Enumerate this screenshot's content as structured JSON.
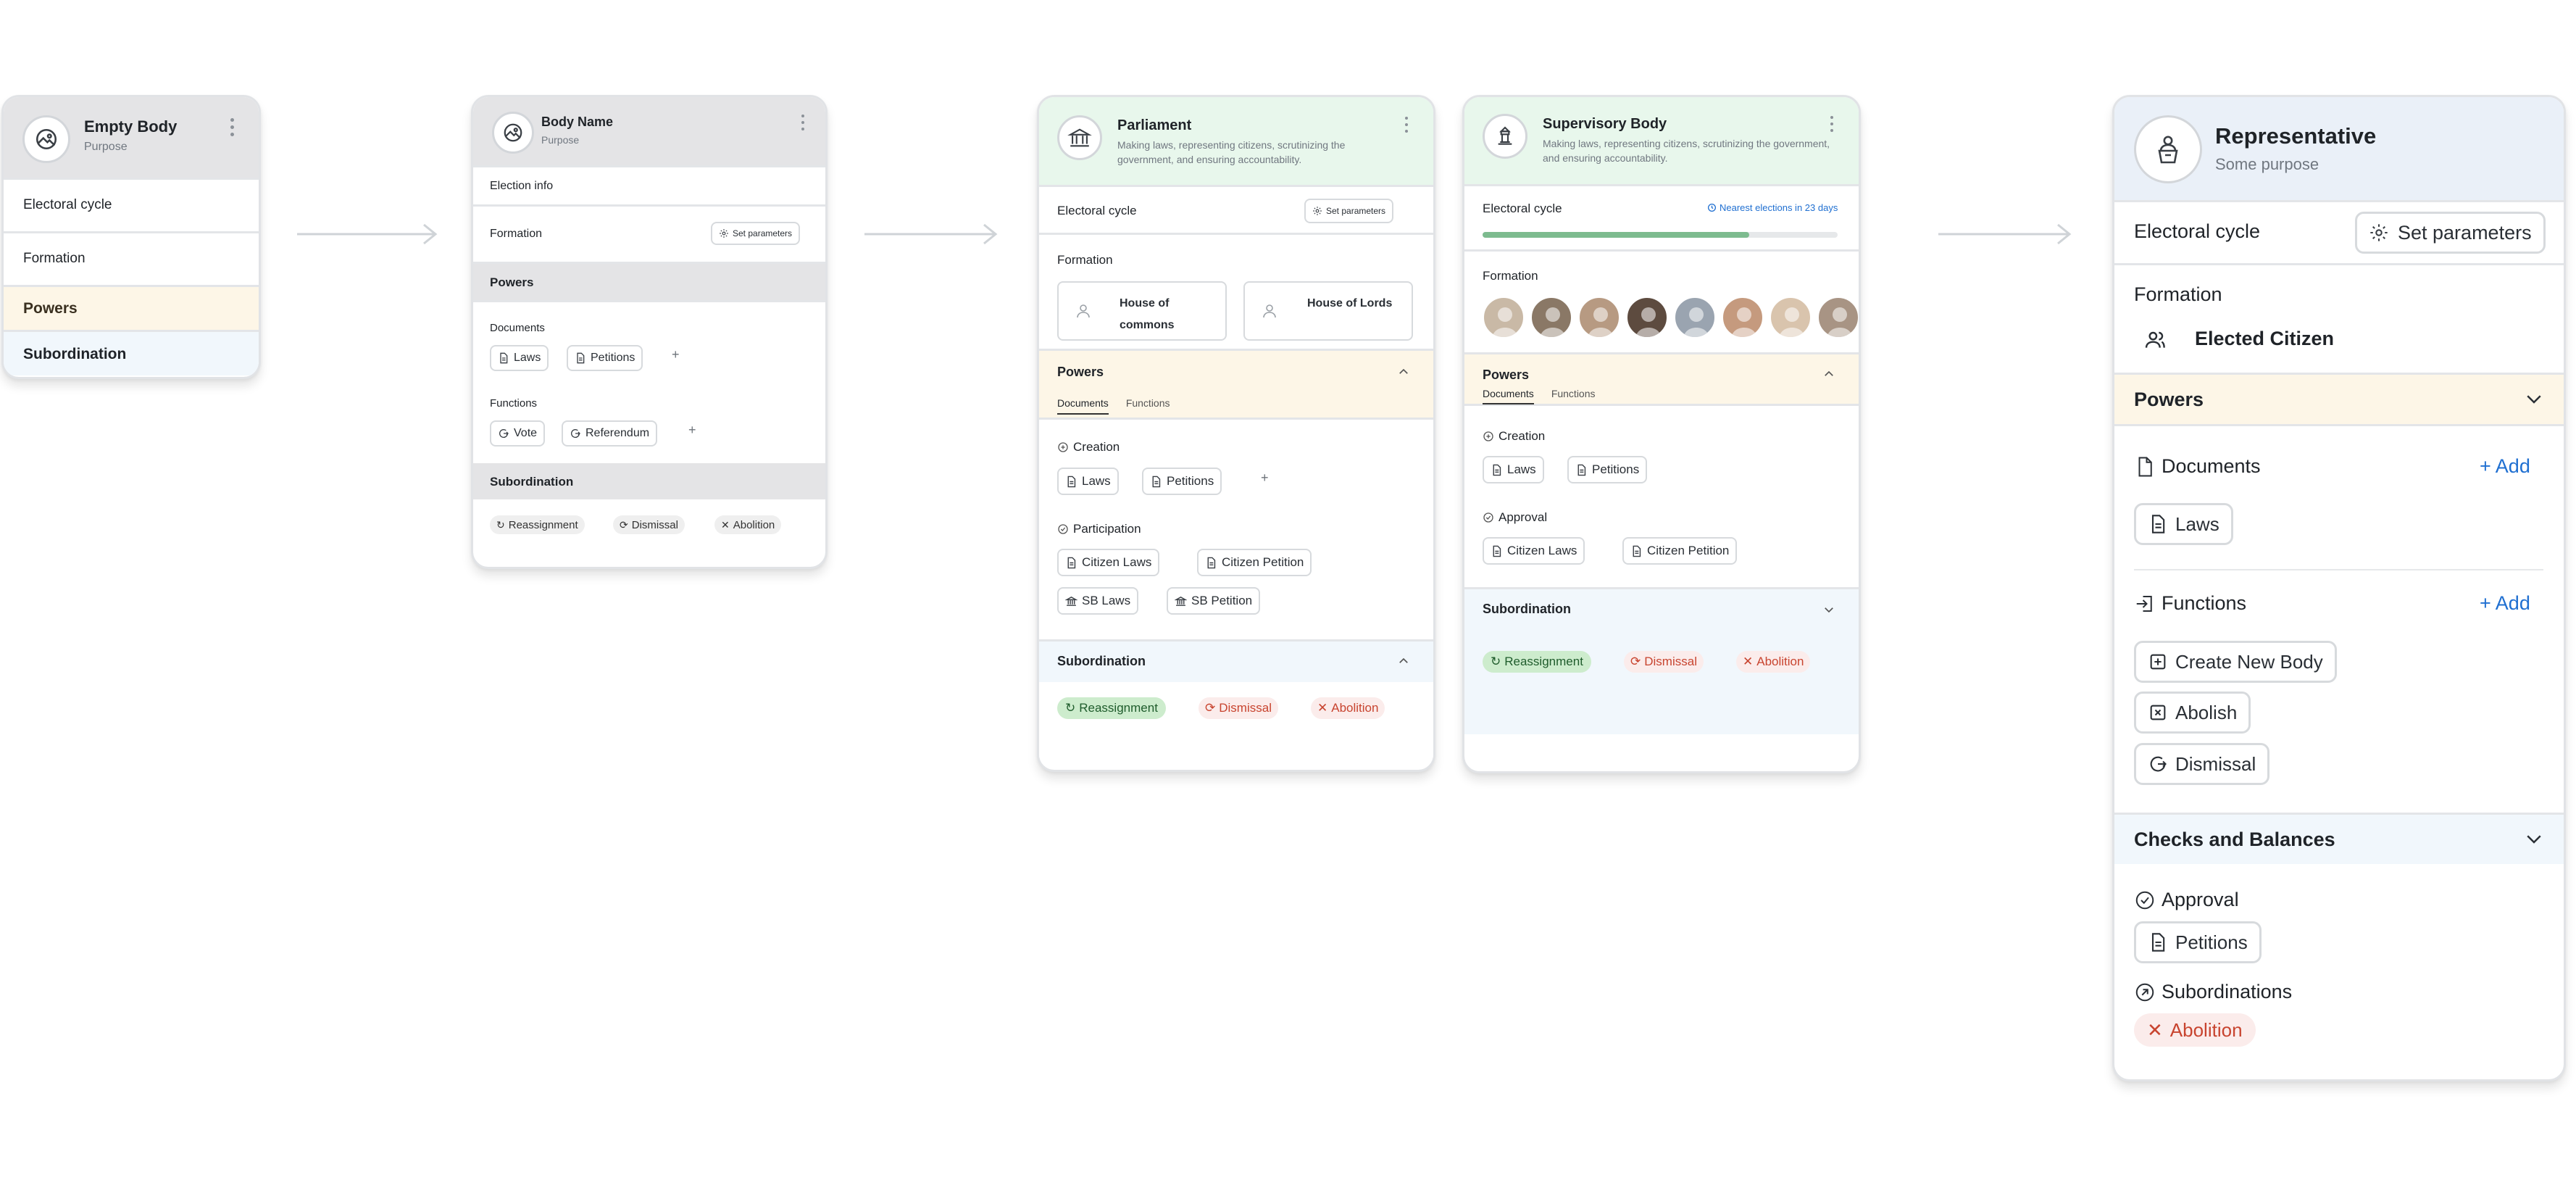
{
  "card1": {
    "title": "Empty Body",
    "subtitle": "Purpose",
    "electoral": "Electoral cycle",
    "formation": "Formation",
    "powers": "Powers",
    "subordination": "Subordination"
  },
  "card2": {
    "title": "Body Name",
    "subtitle": "Purpose",
    "election_info": "Election info",
    "formation": "Formation",
    "set_params": "Set parameters",
    "powers": "Powers",
    "documents": "Documents",
    "doc_chips": [
      "Laws",
      "Petitions"
    ],
    "functions": "Functions",
    "func_chips": [
      "Vote",
      "Referendum"
    ],
    "subordination": "Subordination",
    "sub_tags": [
      "Reassignment",
      "Dismissal",
      "Abolition"
    ]
  },
  "card3": {
    "title": "Parliament",
    "description": "Making laws, representing citizens, scrutinizing the government, and ensuring accountability.",
    "electoral": "Electoral cycle",
    "set_params": "Set parameters",
    "formation": "Formation",
    "houses": [
      "House of commons",
      "House of Lords"
    ],
    "powers": "Powers",
    "tabs": [
      "Documents",
      "Functions"
    ],
    "creation": "Creation",
    "creation_chips": [
      "Laws",
      "Petitions"
    ],
    "participation": "Participation",
    "participation_chips": [
      "Citizen Laws",
      "Citizen Petition",
      "SB Laws",
      "SB Petition"
    ],
    "subordination": "Subordination",
    "sub_tags": [
      "Reassignment",
      "Dismissal",
      "Abolition"
    ]
  },
  "card4": {
    "title": "Supervisory Body",
    "description": "Making laws, representing citizens, scrutinizing the government, and ensuring accountability.",
    "electoral": "Electoral cycle",
    "nearest": "Nearest elections in 23 days",
    "progress": 0.75,
    "formation": "Formation",
    "member_count": 8,
    "powers": "Powers",
    "tabs": [
      "Documents",
      "Functions"
    ],
    "creation": "Creation",
    "creation_chips": [
      "Laws",
      "Petitions"
    ],
    "approval": "Approval",
    "approval_chips": [
      "Citizen Laws",
      "Citizen Petition"
    ],
    "subordination": "Subordination",
    "sub_tags": [
      "Reassignment",
      "Dismissal",
      "Abolition"
    ]
  },
  "card5": {
    "title": "Representative",
    "subtitle": "Some purpose",
    "electoral": "Electoral cycle",
    "set_params": "Set parameters",
    "formation": "Formation",
    "elected": "Elected Citizen",
    "powers": "Powers",
    "documents": "Documents",
    "add": "Add",
    "doc_chips": [
      "Laws"
    ],
    "functions": "Functions",
    "func_chips": [
      "Create New Body",
      "Abolish",
      "Dismissal"
    ],
    "checks": "Checks and Balances",
    "approval": "Approval",
    "approval_chips": [
      "Petitions"
    ],
    "subordinations": "Subordinations",
    "sub_tags": [
      "Abolition"
    ]
  },
  "colors": {
    "powers_bg": "#fdf6e7",
    "subordination_bg": "#f1f7fc",
    "header_grey": "#e4e4e6",
    "header_green": "#e8f7ec",
    "header_blue": "#eaf0f8",
    "progress": "#7dbb8f",
    "green_tag": "#cdeccd",
    "red_text": "#c8442f",
    "link_blue": "#1f6fd1"
  }
}
